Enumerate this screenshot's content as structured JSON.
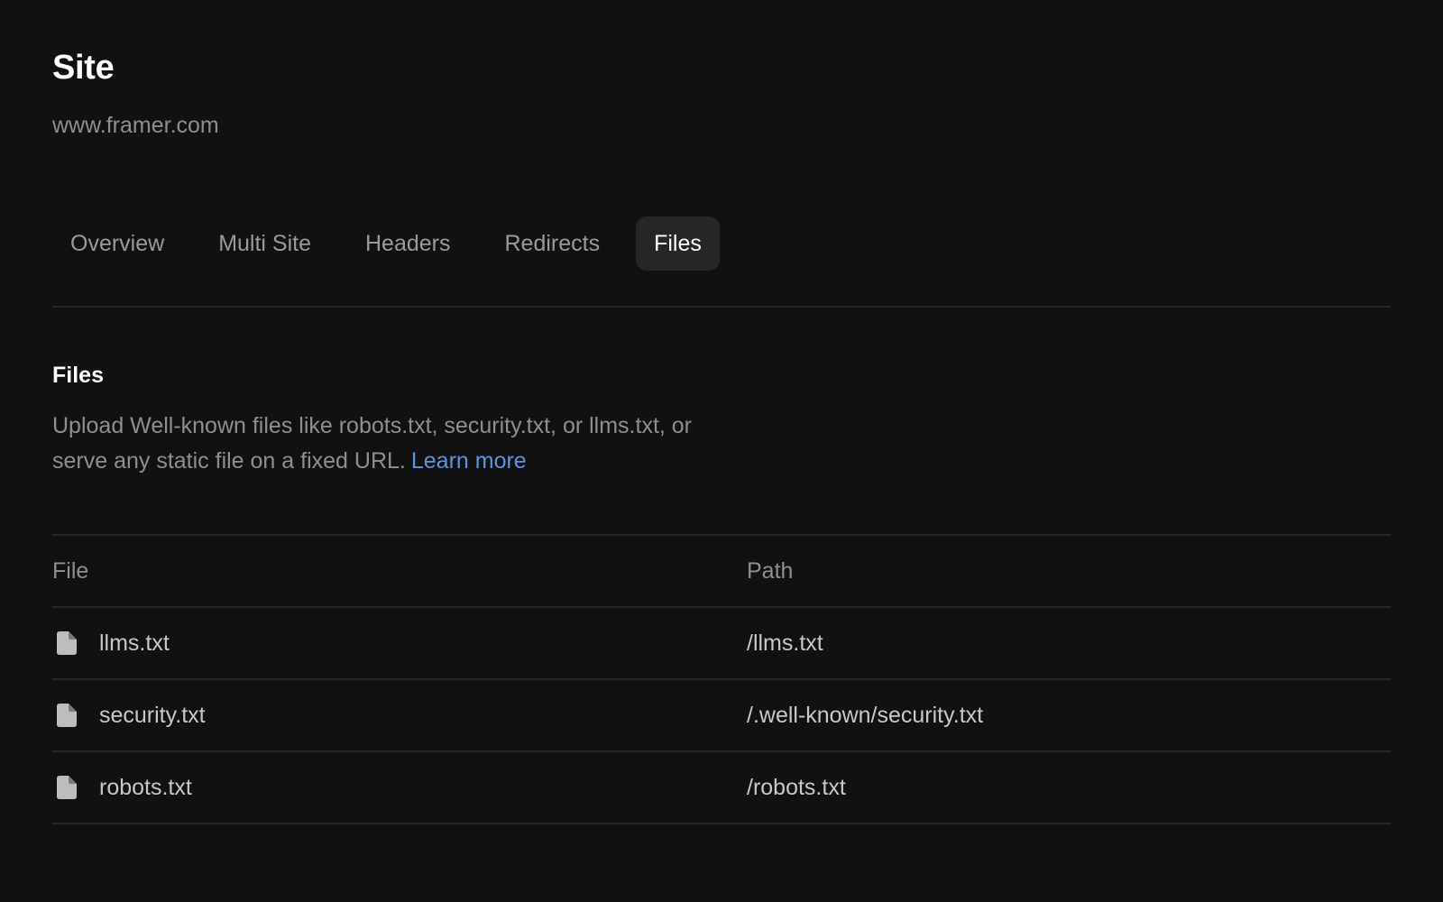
{
  "header": {
    "title": "Site",
    "domain": "www.framer.com"
  },
  "tabs": [
    {
      "label": "Overview",
      "active": false
    },
    {
      "label": "Multi Site",
      "active": false
    },
    {
      "label": "Headers",
      "active": false
    },
    {
      "label": "Redirects",
      "active": false
    },
    {
      "label": "Files",
      "active": true
    }
  ],
  "section": {
    "title": "Files",
    "description": "Upload Well-known files like robots.txt, security.txt, or llms.txt, or serve any static file on a fixed URL.",
    "link_label": "Learn more"
  },
  "table": {
    "columns": {
      "file": "File",
      "path": "Path"
    },
    "rows": [
      {
        "file": "llms.txt",
        "path": "/llms.txt",
        "icon": "file-icon"
      },
      {
        "file": "security.txt",
        "path": "/.well-known/security.txt",
        "icon": "file-icon"
      },
      {
        "file": "robots.txt",
        "path": "/robots.txt",
        "icon": "file-icon"
      }
    ]
  },
  "colors": {
    "background": "#111111",
    "active_tab_bg": "#262626",
    "link": "#5b95df",
    "muted_text": "#8f8f8f",
    "divider": "#262626"
  }
}
